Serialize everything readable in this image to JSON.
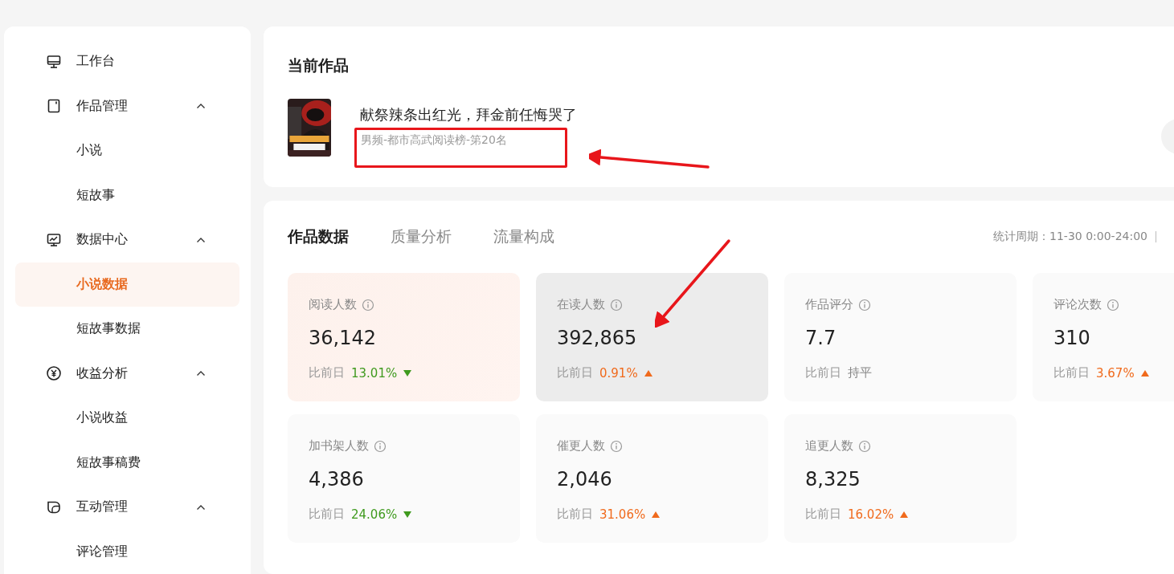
{
  "sidebar": {
    "items": [
      {
        "label": "工作台",
        "expanded": false
      },
      {
        "label": "作品管理",
        "expanded": true,
        "children": [
          {
            "label": "小说",
            "selected": false
          },
          {
            "label": "短故事",
            "selected": false
          }
        ]
      },
      {
        "label": "数据中心",
        "expanded": true,
        "children": [
          {
            "label": "小说数据",
            "selected": true
          },
          {
            "label": "短故事数据",
            "selected": false
          }
        ]
      },
      {
        "label": "收益分析",
        "expanded": true,
        "children": [
          {
            "label": "小说收益",
            "selected": false
          },
          {
            "label": "短故事稿费",
            "selected": false
          }
        ]
      },
      {
        "label": "互动管理",
        "expanded": true,
        "children": [
          {
            "label": "评论管理",
            "selected": false
          }
        ]
      }
    ]
  },
  "current_work": {
    "heading": "当前作品",
    "title": "献祭辣条出红光，拜金前任悔哭了",
    "ranking": "男频-都市高武阅读榜-第20名"
  },
  "stats": {
    "tabs": [
      {
        "label": "作品数据",
        "selected": true
      },
      {
        "label": "质量分析",
        "selected": false
      },
      {
        "label": "流量构成",
        "selected": false
      }
    ],
    "period": "统计周期：11-30 0:00-24:00",
    "metrics": [
      {
        "label": "阅读人数",
        "value": "36,142",
        "compare": "比前日",
        "change": "13.01%",
        "kind": "down",
        "selected": true,
        "hovered": false
      },
      {
        "label": "在读人数",
        "value": "392,865",
        "compare": "比前日",
        "change": "0.91%",
        "kind": "up",
        "selected": false,
        "hovered": true
      },
      {
        "label": "作品评分",
        "value": "7.7",
        "compare": "比前日",
        "change": "持平",
        "kind": "flat",
        "selected": false,
        "hovered": false
      },
      {
        "label": "评论次数",
        "value": "310",
        "compare": "比前日",
        "change": "3.67%",
        "kind": "up",
        "selected": false,
        "hovered": false
      },
      {
        "label": "加书架人数",
        "value": "4,386",
        "compare": "比前日",
        "change": "24.06%",
        "kind": "down",
        "selected": false,
        "hovered": false
      },
      {
        "label": "催更人数",
        "value": "2,046",
        "compare": "比前日",
        "change": "31.06%",
        "kind": "up",
        "selected": false,
        "hovered": false
      },
      {
        "label": "追更人数",
        "value": "8,325",
        "compare": "比前日",
        "change": "16.02%",
        "kind": "up",
        "selected": false,
        "hovered": false
      }
    ]
  },
  "annotations": [
    {
      "kind": "box"
    },
    {
      "kind": "arrow"
    },
    {
      "kind": "arrow"
    }
  ]
}
